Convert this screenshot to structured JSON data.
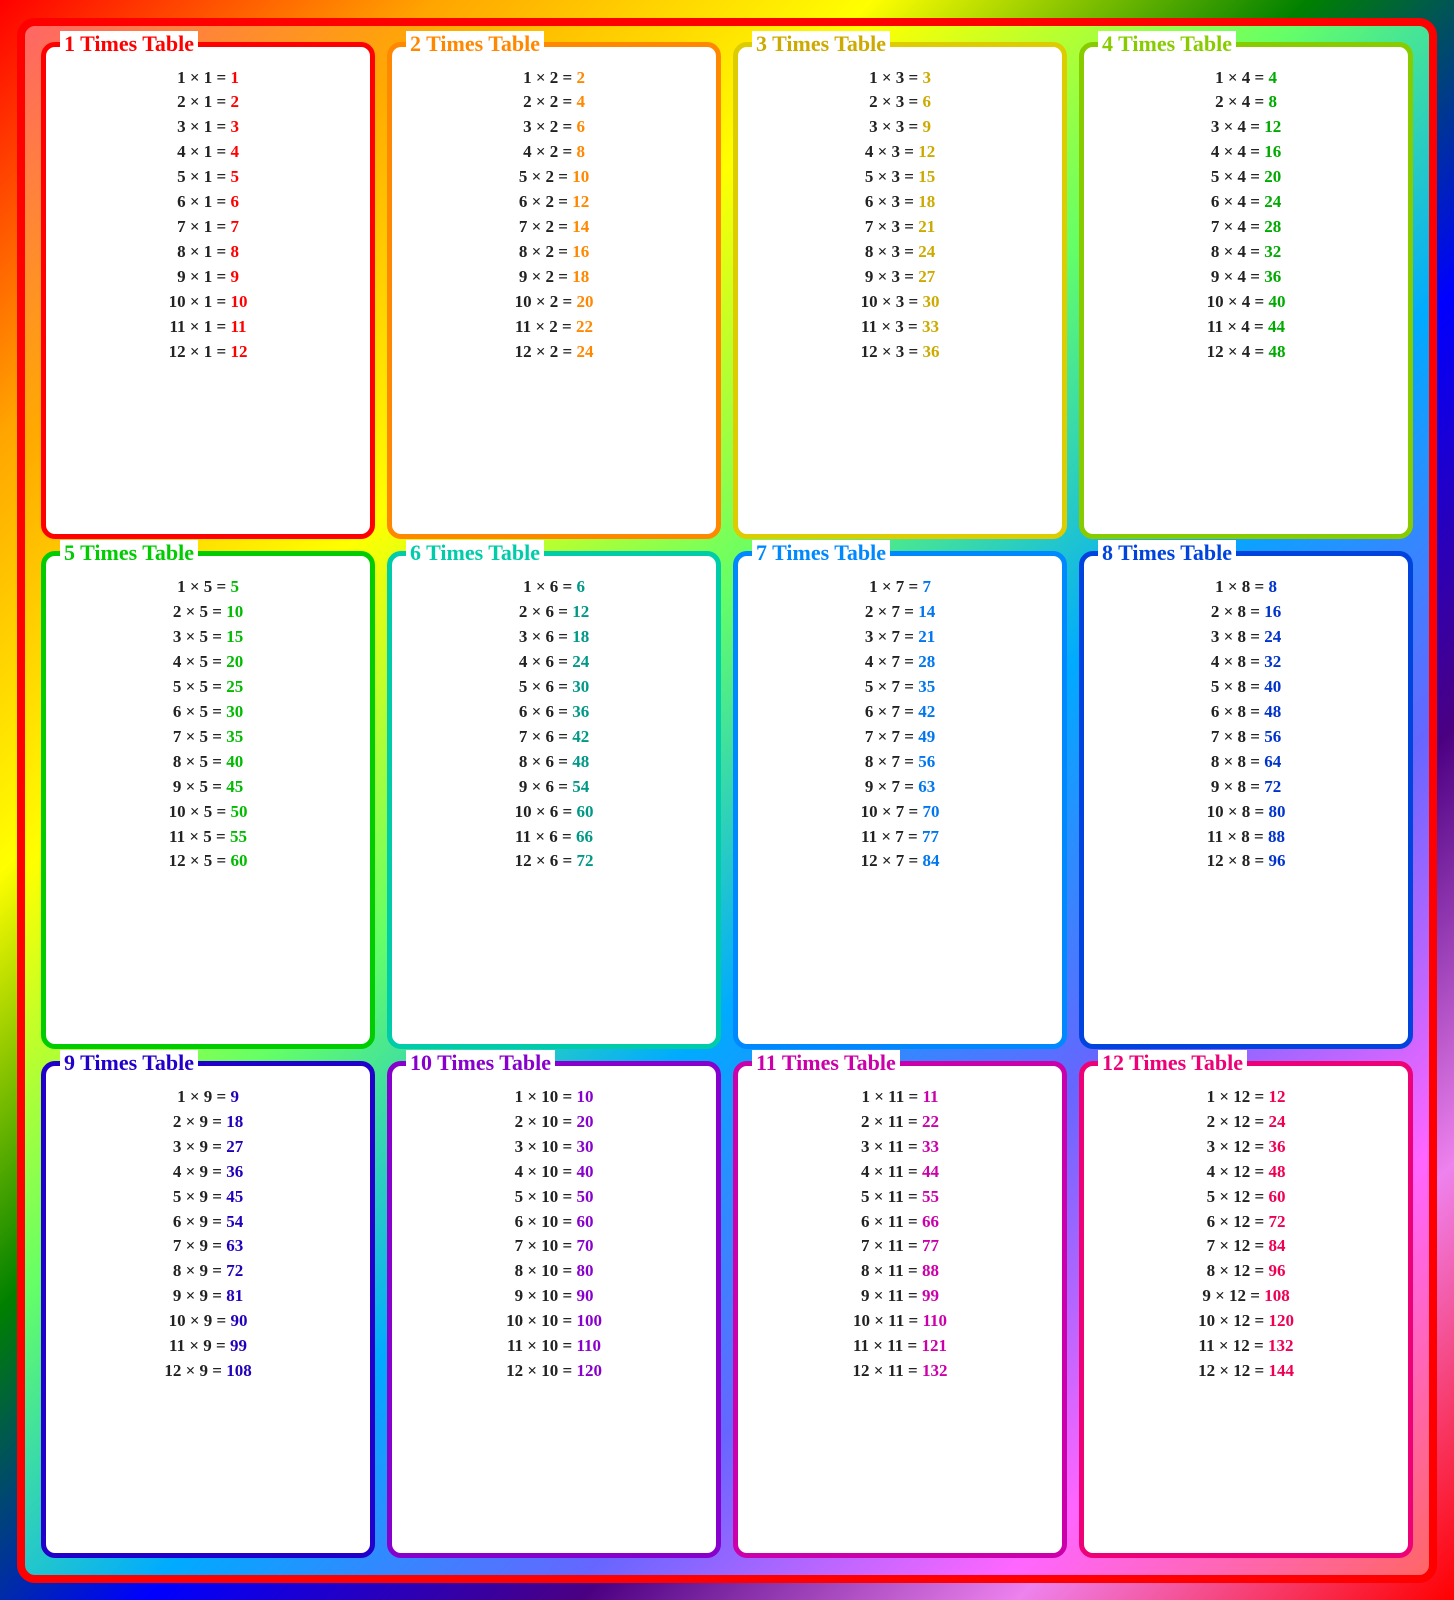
{
  "tables": [
    {
      "id": 1,
      "title": "1 Times Table",
      "titleClass": "title-1",
      "cardClass": "card-1",
      "resultClass": "eq-result-1",
      "multiplier": 1,
      "rows": [
        {
          "eq": "1 × 1 =",
          "result": "1"
        },
        {
          "eq": "2 × 1 =",
          "result": "2"
        },
        {
          "eq": "3 × 1 =",
          "result": "3"
        },
        {
          "eq": "4 × 1 =",
          "result": "4"
        },
        {
          "eq": "5 × 1 =",
          "result": "5"
        },
        {
          "eq": "6 × 1 =",
          "result": "6"
        },
        {
          "eq": "7 × 1 =",
          "result": "7"
        },
        {
          "eq": "8 × 1 =",
          "result": "8"
        },
        {
          "eq": "9 × 1 =",
          "result": "9"
        },
        {
          "eq": "10 × 1 =",
          "result": "10"
        },
        {
          "eq": "11 × 1 =",
          "result": "11"
        },
        {
          "eq": "12 × 1 =",
          "result": "12"
        }
      ]
    },
    {
      "id": 2,
      "title": "2 Times Table",
      "titleClass": "title-2",
      "cardClass": "card-2",
      "resultClass": "eq-result-2",
      "rows": [
        {
          "eq": "1 × 2 =",
          "result": "2"
        },
        {
          "eq": "2 × 2 =",
          "result": "4"
        },
        {
          "eq": "3 × 2 =",
          "result": "6"
        },
        {
          "eq": "4 × 2 =",
          "result": "8"
        },
        {
          "eq": "5 × 2 =",
          "result": "10"
        },
        {
          "eq": "6 × 2 =",
          "result": "12"
        },
        {
          "eq": "7 × 2 =",
          "result": "14"
        },
        {
          "eq": "8 × 2 =",
          "result": "16"
        },
        {
          "eq": "9 × 2 =",
          "result": "18"
        },
        {
          "eq": "10 × 2 =",
          "result": "20"
        },
        {
          "eq": "11 × 2 =",
          "result": "22"
        },
        {
          "eq": "12 × 2 =",
          "result": "24"
        }
      ]
    },
    {
      "id": 3,
      "title": "3 Times Table",
      "titleClass": "title-3",
      "cardClass": "card-3",
      "resultClass": "eq-result-3",
      "rows": [
        {
          "eq": "1 × 3 =",
          "result": "3"
        },
        {
          "eq": "2 × 3 =",
          "result": "6"
        },
        {
          "eq": "3 × 3 =",
          "result": "9"
        },
        {
          "eq": "4 × 3 =",
          "result": "12"
        },
        {
          "eq": "5 × 3 =",
          "result": "15"
        },
        {
          "eq": "6 × 3 =",
          "result": "18"
        },
        {
          "eq": "7 × 3 =",
          "result": "21"
        },
        {
          "eq": "8 × 3 =",
          "result": "24"
        },
        {
          "eq": "9 × 3 =",
          "result": "27"
        },
        {
          "eq": "10 × 3 =",
          "result": "30"
        },
        {
          "eq": "11 × 3 =",
          "result": "33"
        },
        {
          "eq": "12 × 3 =",
          "result": "36"
        }
      ]
    },
    {
      "id": 4,
      "title": "4 Times Table",
      "titleClass": "title-4",
      "cardClass": "card-4",
      "resultClass": "eq-result-4",
      "rows": [
        {
          "eq": "1 × 4 =",
          "result": "4"
        },
        {
          "eq": "2 × 4 =",
          "result": "8"
        },
        {
          "eq": "3 × 4 =",
          "result": "12"
        },
        {
          "eq": "4 × 4 =",
          "result": "16"
        },
        {
          "eq": "5 × 4 =",
          "result": "20"
        },
        {
          "eq": "6 × 4 =",
          "result": "24"
        },
        {
          "eq": "7 × 4 =",
          "result": "28"
        },
        {
          "eq": "8 × 4 =",
          "result": "32"
        },
        {
          "eq": "9 × 4 =",
          "result": "36"
        },
        {
          "eq": "10 × 4 =",
          "result": "40"
        },
        {
          "eq": "11 × 4 =",
          "result": "44"
        },
        {
          "eq": "12 × 4 =",
          "result": "48"
        }
      ]
    },
    {
      "id": 5,
      "title": "5 Times Table",
      "titleClass": "title-5",
      "cardClass": "card-5",
      "resultClass": "eq-result-5",
      "rows": [
        {
          "eq": "1 × 5 =",
          "result": "5"
        },
        {
          "eq": "2 × 5 =",
          "result": "10"
        },
        {
          "eq": "3 × 5 =",
          "result": "15"
        },
        {
          "eq": "4 × 5 =",
          "result": "20"
        },
        {
          "eq": "5 × 5 =",
          "result": "25"
        },
        {
          "eq": "6 × 5 =",
          "result": "30"
        },
        {
          "eq": "7 × 5 =",
          "result": "35"
        },
        {
          "eq": "8 × 5 =",
          "result": "40"
        },
        {
          "eq": "9 × 5 =",
          "result": "45"
        },
        {
          "eq": "10 × 5 =",
          "result": "50"
        },
        {
          "eq": "11 × 5 =",
          "result": "55"
        },
        {
          "eq": "12 × 5 =",
          "result": "60"
        }
      ]
    },
    {
      "id": 6,
      "title": "6 Times Table",
      "titleClass": "title-6",
      "cardClass": "card-6",
      "resultClass": "eq-result-6",
      "rows": [
        {
          "eq": "1 × 6 =",
          "result": "6"
        },
        {
          "eq": "2 × 6 =",
          "result": "12"
        },
        {
          "eq": "3 × 6 =",
          "result": "18"
        },
        {
          "eq": "4 × 6 =",
          "result": "24"
        },
        {
          "eq": "5 × 6 =",
          "result": "30"
        },
        {
          "eq": "6 × 6 =",
          "result": "36"
        },
        {
          "eq": "7 × 6 =",
          "result": "42"
        },
        {
          "eq": "8 × 6 =",
          "result": "48"
        },
        {
          "eq": "9 × 6 =",
          "result": "54"
        },
        {
          "eq": "10 × 6 =",
          "result": "60"
        },
        {
          "eq": "11 × 6 =",
          "result": "66"
        },
        {
          "eq": "12 × 6 =",
          "result": "72"
        }
      ]
    },
    {
      "id": 7,
      "title": "7 Times Table",
      "titleClass": "title-7",
      "cardClass": "card-7",
      "resultClass": "eq-result-7",
      "rows": [
        {
          "eq": "1 × 7 =",
          "result": "7"
        },
        {
          "eq": "2 × 7 =",
          "result": "14"
        },
        {
          "eq": "3 × 7 =",
          "result": "21"
        },
        {
          "eq": "4 × 7 =",
          "result": "28"
        },
        {
          "eq": "5 × 7 =",
          "result": "35"
        },
        {
          "eq": "6 × 7 =",
          "result": "42"
        },
        {
          "eq": "7 × 7 =",
          "result": "49"
        },
        {
          "eq": "8 × 7 =",
          "result": "56"
        },
        {
          "eq": "9 × 7 =",
          "result": "63"
        },
        {
          "eq": "10 × 7 =",
          "result": "70"
        },
        {
          "eq": "11 × 7 =",
          "result": "77"
        },
        {
          "eq": "12 × 7 =",
          "result": "84"
        }
      ]
    },
    {
      "id": 8,
      "title": "8 Times Table",
      "titleClass": "title-8",
      "cardClass": "card-8",
      "resultClass": "eq-result-8",
      "rows": [
        {
          "eq": "1 × 8 =",
          "result": "8"
        },
        {
          "eq": "2 × 8 =",
          "result": "16"
        },
        {
          "eq": "3 × 8 =",
          "result": "24"
        },
        {
          "eq": "4 × 8 =",
          "result": "32"
        },
        {
          "eq": "5 × 8 =",
          "result": "40"
        },
        {
          "eq": "6 × 8 =",
          "result": "48"
        },
        {
          "eq": "7 × 8 =",
          "result": "56"
        },
        {
          "eq": "8 × 8 =",
          "result": "64"
        },
        {
          "eq": "9 × 8 =",
          "result": "72"
        },
        {
          "eq": "10 × 8 =",
          "result": "80"
        },
        {
          "eq": "11 × 8 =",
          "result": "88"
        },
        {
          "eq": "12 × 8 =",
          "result": "96"
        }
      ]
    },
    {
      "id": 9,
      "title": "9 Times Table",
      "titleClass": "title-9",
      "cardClass": "card-9",
      "resultClass": "eq-result-9",
      "rows": [
        {
          "eq": "1 × 9 =",
          "result": "9"
        },
        {
          "eq": "2 × 9 =",
          "result": "18"
        },
        {
          "eq": "3 × 9 =",
          "result": "27"
        },
        {
          "eq": "4 × 9 =",
          "result": "36"
        },
        {
          "eq": "5 × 9 =",
          "result": "45"
        },
        {
          "eq": "6 × 9 =",
          "result": "54"
        },
        {
          "eq": "7 × 9 =",
          "result": "63"
        },
        {
          "eq": "8 × 9 =",
          "result": "72"
        },
        {
          "eq": "9 × 9 =",
          "result": "81"
        },
        {
          "eq": "10 × 9 =",
          "result": "90"
        },
        {
          "eq": "11 × 9 =",
          "result": "99"
        },
        {
          "eq": "12 × 9 =",
          "result": "108"
        }
      ]
    },
    {
      "id": 10,
      "title": "10 Times Table",
      "titleClass": "title-10",
      "cardClass": "card-10",
      "resultClass": "eq-result-10",
      "rows": [
        {
          "eq": "1 × 10 =",
          "result": "10"
        },
        {
          "eq": "2 × 10 =",
          "result": "20"
        },
        {
          "eq": "3 × 10 =",
          "result": "30"
        },
        {
          "eq": "4 × 10 =",
          "result": "40"
        },
        {
          "eq": "5 × 10 =",
          "result": "50"
        },
        {
          "eq": "6 × 10 =",
          "result": "60"
        },
        {
          "eq": "7 × 10 =",
          "result": "70"
        },
        {
          "eq": "8 × 10 =",
          "result": "80"
        },
        {
          "eq": "9 × 10 =",
          "result": "90"
        },
        {
          "eq": "10 × 10 =",
          "result": "100"
        },
        {
          "eq": "11 × 10 =",
          "result": "110"
        },
        {
          "eq": "12 × 10 =",
          "result": "120"
        }
      ]
    },
    {
      "id": 11,
      "title": "11 Times Table",
      "titleClass": "title-11",
      "cardClass": "card-11",
      "resultClass": "eq-result-11",
      "rows": [
        {
          "eq": "1 × 11 =",
          "result": "11"
        },
        {
          "eq": "2 × 11 =",
          "result": "22"
        },
        {
          "eq": "3 × 11 =",
          "result": "33"
        },
        {
          "eq": "4 × 11 =",
          "result": "44"
        },
        {
          "eq": "5 × 11 =",
          "result": "55"
        },
        {
          "eq": "6 × 11 =",
          "result": "66"
        },
        {
          "eq": "7 × 11 =",
          "result": "77"
        },
        {
          "eq": "8 × 11 =",
          "result": "88"
        },
        {
          "eq": "9 × 11 =",
          "result": "99"
        },
        {
          "eq": "10 × 11 =",
          "result": "110"
        },
        {
          "eq": "11 × 11 =",
          "result": "121"
        },
        {
          "eq": "12 × 11 =",
          "result": "132"
        }
      ]
    },
    {
      "id": 12,
      "title": "12 Times Table",
      "titleClass": "title-12",
      "cardClass": "card-12",
      "resultClass": "eq-result-12",
      "rows": [
        {
          "eq": "1 × 12 =",
          "result": "12"
        },
        {
          "eq": "2 × 12 =",
          "result": "24"
        },
        {
          "eq": "3 × 12 =",
          "result": "36"
        },
        {
          "eq": "4 × 12 =",
          "result": "48"
        },
        {
          "eq": "5 × 12 =",
          "result": "60"
        },
        {
          "eq": "6 × 12 =",
          "result": "72"
        },
        {
          "eq": "7 × 12 =",
          "result": "84"
        },
        {
          "eq": "8 × 12 =",
          "result": "96"
        },
        {
          "eq": "9 × 12 =",
          "result": "108"
        },
        {
          "eq": "10 × 12 =",
          "result": "120"
        },
        {
          "eq": "11 × 12 =",
          "result": "132"
        },
        {
          "eq": "12 × 12 =",
          "result": "144"
        }
      ]
    }
  ]
}
